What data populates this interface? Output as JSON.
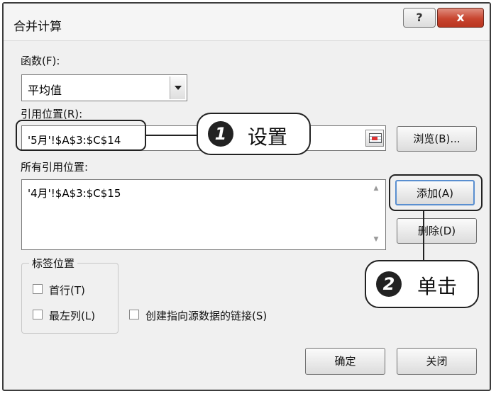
{
  "dialog": {
    "title": "合并计算",
    "help_label": "?",
    "close_label": "x"
  },
  "function": {
    "label": "函数(F):",
    "selected": "平均值"
  },
  "reference": {
    "label": "引用位置(R):",
    "value": "'5月'!$A$3:$C$14",
    "browse_label": "浏览(B)..."
  },
  "all_references": {
    "label": "所有引用位置:",
    "items": [
      "'4月'!$A$3:$C$15"
    ],
    "add_label": "添加(A)",
    "delete_label": "删除(D)"
  },
  "label_position": {
    "group_label": "标签位置",
    "top_row": "首行(T)",
    "left_column": "最左列(L)",
    "create_links": "创建指向源数据的链接(S)"
  },
  "footer": {
    "ok_label": "确定",
    "close_label": "关闭"
  },
  "callouts": [
    {
      "number": "1",
      "text": "设置"
    },
    {
      "number": "2",
      "text": "单击"
    }
  ],
  "colors": {
    "close_button": "#c8452f",
    "dialog_bg": "#f0f0f0",
    "callout_border": "#222222"
  }
}
